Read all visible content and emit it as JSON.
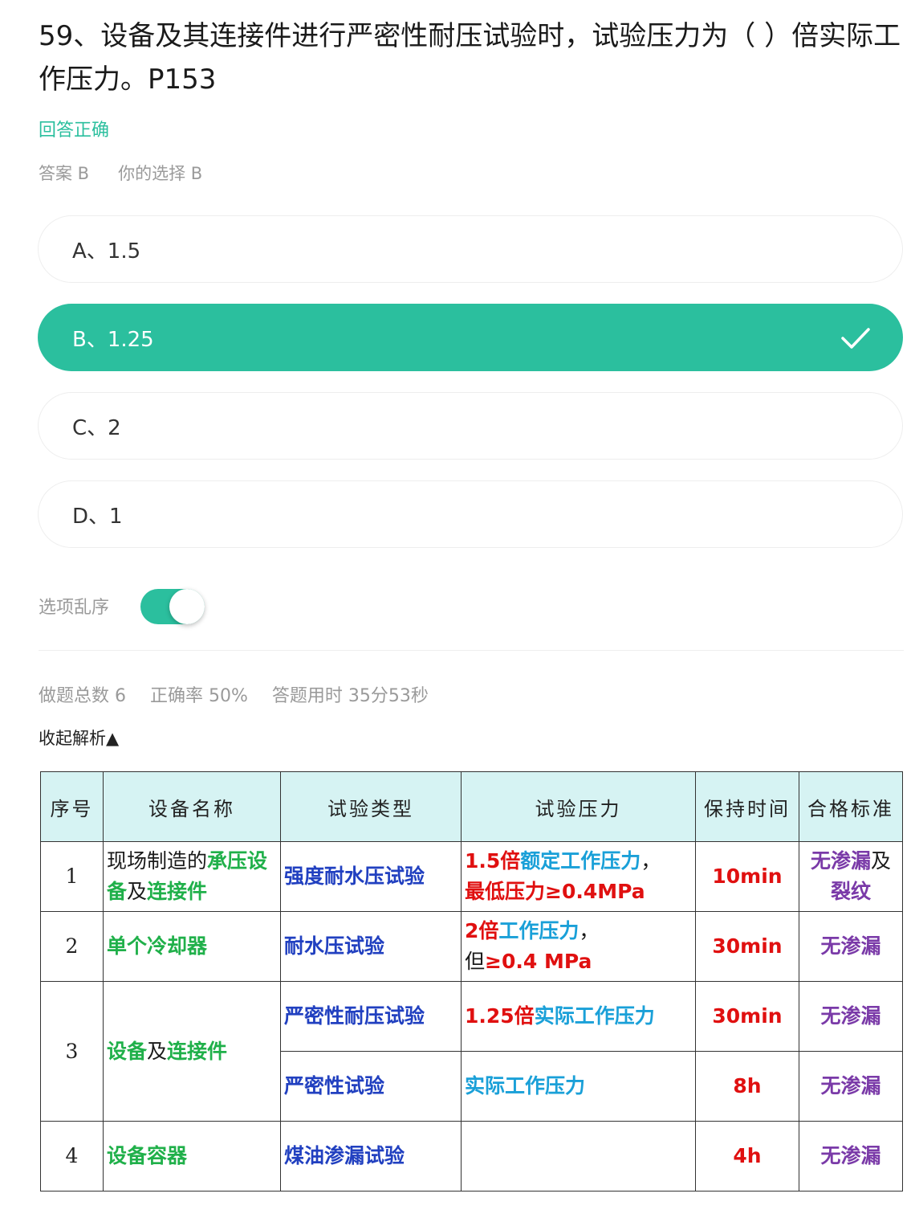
{
  "question": {
    "text": "59、设备及其连接件进行严密性耐压试验时，试验压力为（ ）倍实际工作压力。P153"
  },
  "result": "回答正确",
  "answer": {
    "correct": "答案 B",
    "chosen": "你的选择 B"
  },
  "options": [
    {
      "label": "A、1.5",
      "selected": false
    },
    {
      "label": "B、1.25",
      "selected": true,
      "icon": "check-icon"
    },
    {
      "label": "C、2",
      "selected": false
    },
    {
      "label": "D、1",
      "selected": false
    }
  ],
  "shuffle": {
    "label": "选项乱序",
    "on": true
  },
  "stats": {
    "total": "做题总数 6",
    "rate": "正确率 50%",
    "time": "答题用时 35分53秒"
  },
  "collapse_label": "收起解析▲",
  "colors": {
    "accent": "#2bbf9e",
    "green": "#20b04a",
    "blue": "#2140c0",
    "red": "#e01010",
    "cyan": "#1aa0d8",
    "purple": "#7a3aa8"
  },
  "table": {
    "headers": [
      "序号",
      "设备名称",
      "试验类型",
      "试验压力",
      "保持时间",
      "合格标准"
    ],
    "r1": {
      "no": "1",
      "name_a": "现场制造的",
      "name_b": "承压设备",
      "name_c": "及",
      "name_d": "连接件",
      "type": "强度耐水压试验",
      "p_a": "1.5倍",
      "p_b": "额定工作压力",
      "p_c": "，",
      "p_d": "最低压力≥0.4MPa",
      "time": "10min",
      "std_a": "无渗漏",
      "std_b": "及",
      "std_c": "裂纹"
    },
    "r2": {
      "no": "2",
      "name": "单个冷却器",
      "type": "耐水压试验",
      "p_a": "2倍",
      "p_b": "工作压力",
      "p_c": "，",
      "p_d": "但",
      "p_e": "≥0.4 MPa",
      "time": "30min",
      "std": "无渗漏"
    },
    "r3": {
      "no": "3",
      "name_a": "设备",
      "name_b": "及",
      "name_c": "连接件",
      "type1": "严密性耐压试验",
      "p1_a": "1.25倍",
      "p1_b": "实际工作压力",
      "time1": "30min",
      "std1": "无渗漏",
      "type2": "严密性试验",
      "p2": "实际工作压力",
      "time2": "8h",
      "std2": "无渗漏"
    },
    "r4": {
      "no": "4",
      "name": "设备容器",
      "type": "煤油渗漏试验",
      "p": "",
      "time": "4h",
      "std": "无渗漏"
    }
  }
}
